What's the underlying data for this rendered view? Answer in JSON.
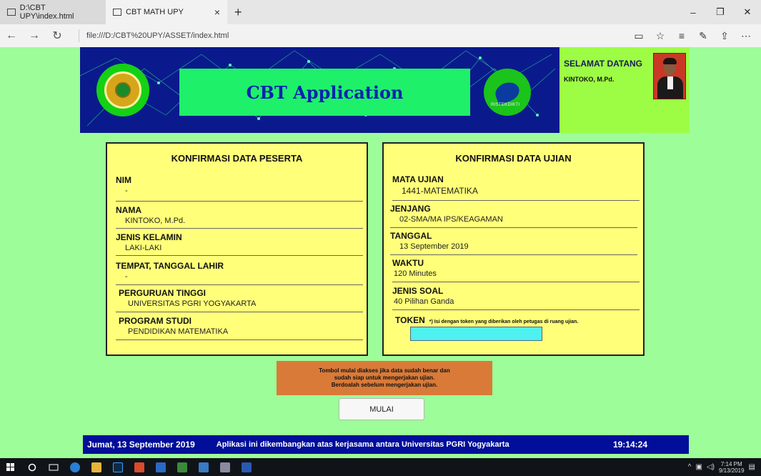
{
  "browser": {
    "tabs": [
      {
        "label": "D:\\CBT UPY\\index.html"
      },
      {
        "label": "CBT MATH UPY"
      }
    ],
    "new_tab": "+",
    "close_tab": "×",
    "url": "file:///D:/CBT%20UPY/ASSET/index.html",
    "controls": {
      "minimize": "–",
      "restore": "❐",
      "close": "✕"
    },
    "nav": {
      "back": "←",
      "forward": "→",
      "refresh": "↻"
    },
    "tools": {
      "reading": "▭",
      "favorite": "☆",
      "hub": "≡",
      "notes": "✎",
      "share": "⇪",
      "more": "⋯"
    }
  },
  "banner": {
    "title": "CBT Application",
    "right_logo_text": "RISTEKDIKTI"
  },
  "welcome": {
    "heading": "SELAMAT DATANG",
    "name": "KINTOKO, M.Pd."
  },
  "participant": {
    "title": "KONFIRMASI DATA PESERTA",
    "fields": [
      {
        "label": "NIM",
        "value": "-"
      },
      {
        "label": "NAMA",
        "value": "KINTOKO, M.Pd."
      },
      {
        "label": "JENIS KELAMIN",
        "value": "LAKI-LAKI"
      },
      {
        "label": "TEMPAT, TANGGAL LAHIR",
        "value": "-"
      },
      {
        "label": "PERGURUAN TINGGI",
        "value": "UNIVERSITAS PGRI YOGYAKARTA"
      },
      {
        "label": "PROGRAM STUDI",
        "value": "PENDIDIKAN MATEMATIKA"
      }
    ]
  },
  "exam": {
    "title": "KONFIRMASI DATA UJIAN",
    "fields": [
      {
        "label": "MATA UJIAN",
        "value": "1441-MATEMATIKA"
      },
      {
        "label": "JENJANG",
        "value": "02-SMA/MA IPS/KEAGAMAN"
      },
      {
        "label": "TANGGAL",
        "value": "13  September  2019"
      },
      {
        "label": "WAKTU",
        "value": "120 Minutes"
      },
      {
        "label": "JENIS SOAL",
        "value": "40 Pilihan Ganda"
      }
    ],
    "token_label": "TOKEN",
    "token_note": "*) Isi dengan token yang diberikan oleh petugas di ruang ujian.",
    "token_value": ""
  },
  "notice": {
    "line1": "Tombol mulai diakses jika data sudah benar dan",
    "line2": "sudah siap untuk mengerjakan ujian.",
    "line3": "Berdoalah sebelum mengerjakan ujian."
  },
  "start_button": "MULAI",
  "footer": {
    "date": "Jumat, 13  September  2019",
    "message": "Aplikasi ini dikembangkan atas kerjasama antara Universitas PGRI Yogyakarta",
    "time": "19:14:24"
  },
  "taskbar": {
    "time": "7:14 PM",
    "date": "9/13/2019"
  }
}
